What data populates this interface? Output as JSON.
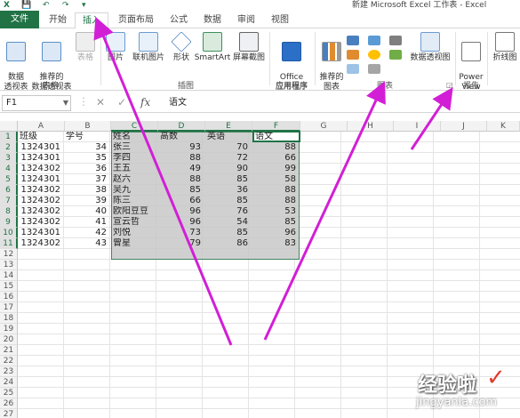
{
  "titlebar": {
    "title": "新建 Microsoft Excel 工作表 - Excel",
    "quick_access": [
      "X",
      "💾",
      "↶",
      "↷",
      "▾"
    ]
  },
  "tabs": [
    "文件",
    "开始",
    "插入",
    "页面布局",
    "公式",
    "数据",
    "审阅",
    "视图"
  ],
  "active_tab": "插入",
  "ribbon": {
    "buttons": {
      "pivot": "数据\n透视表",
      "rec_pivot": "推荐的\n数据透视表",
      "table": "表格",
      "picture": "图片",
      "online_pic": "联机图片",
      "shapes": "形状",
      "smartart": "SmartArt",
      "screenshot": "屏幕截图",
      "office_apps": "Office\n应用程序",
      "rec_charts": "推荐的\n图表",
      "pivot_chart": "数据透视图",
      "power_view": "Power\nView",
      "sparkline": "折线图"
    },
    "groups": {
      "tables": "表格",
      "illustrations": "插图",
      "apps": "应用程序",
      "charts": "图表",
      "reports": "报告"
    }
  },
  "formula_bar": {
    "name_box": "F1",
    "fx": "fx",
    "content": "语文"
  },
  "columns": [
    "A",
    "B",
    "C",
    "D",
    "E",
    "F",
    "G",
    "H",
    "I",
    "J",
    "K"
  ],
  "rows": [
    "1",
    "2",
    "3",
    "4",
    "5",
    "6",
    "7",
    "8",
    "9",
    "10",
    "11",
    "12",
    "13",
    "14",
    "15",
    "16",
    "17",
    "18",
    "19",
    "20",
    "21",
    "22",
    "23",
    "24",
    "25",
    "26",
    "27"
  ],
  "headers": {
    "a": "班级",
    "b": "学号",
    "c": "姓名",
    "d": "高数",
    "e": "英语",
    "f": "语文"
  },
  "table_rows": [
    {
      "a": "1324301",
      "b": "34",
      "c": "张三",
      "d": "93",
      "e": "70",
      "f": "88"
    },
    {
      "a": "1324301",
      "b": "35",
      "c": "李四",
      "d": "88",
      "e": "72",
      "f": "66"
    },
    {
      "a": "1324302",
      "b": "36",
      "c": "王五",
      "d": "49",
      "e": "90",
      "f": "99"
    },
    {
      "a": "1324301",
      "b": "37",
      "c": "赵六",
      "d": "88",
      "e": "85",
      "f": "58"
    },
    {
      "a": "1324302",
      "b": "38",
      "c": "吴九",
      "d": "85",
      "e": "36",
      "f": "88"
    },
    {
      "a": "1324302",
      "b": "39",
      "c": "陈三",
      "d": "66",
      "e": "85",
      "f": "88"
    },
    {
      "a": "1324302",
      "b": "40",
      "c": "欧阳豆豆",
      "d": "96",
      "e": "76",
      "f": "53"
    },
    {
      "a": "1324302",
      "b": "41",
      "c": "宣云哲",
      "d": "96",
      "e": "54",
      "f": "85"
    },
    {
      "a": "1324301",
      "b": "42",
      "c": "刘悦",
      "d": "73",
      "e": "85",
      "f": "96"
    },
    {
      "a": "1324302",
      "b": "43",
      "c": "曾星",
      "d": "79",
      "e": "86",
      "f": "83"
    }
  ],
  "watermark": {
    "line1": "经验啦",
    "line2": "jingyanla.com",
    "check": "✓"
  },
  "colors": {
    "excel_green": "#217346",
    "arrow_magenta": "#d21fd6"
  }
}
